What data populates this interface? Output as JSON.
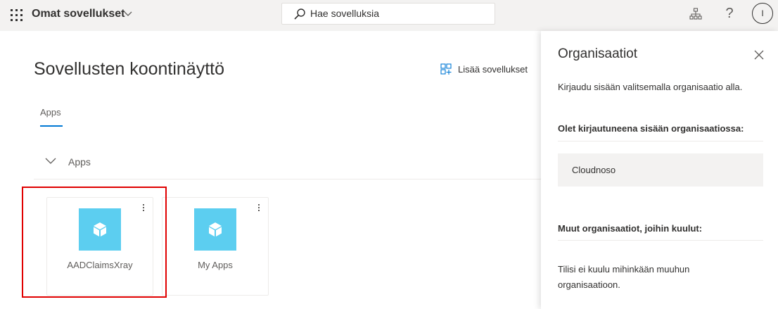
{
  "topbar": {
    "app_title": "Omat sovellukset",
    "search_placeholder": "Hae sovelluksia",
    "help_label": "?",
    "avatar_initial": "I"
  },
  "main": {
    "page_title": "Sovellusten koontinäyttö",
    "add_apps_label": "Lisää sovellukset",
    "tabs": [
      {
        "label": "Apps",
        "active": true
      }
    ],
    "section": {
      "label": "Apps"
    },
    "tiles": [
      {
        "label": "AADClaimsXray",
        "icon": "cube-icon",
        "highlighted": true
      },
      {
        "label": "My Apps",
        "icon": "cube-icon",
        "highlighted": false
      }
    ]
  },
  "panel": {
    "title": "Organisaatiot",
    "intro": "Kirjaudu sisään valitsemalla organisaatio alla.",
    "current_heading": "Olet kirjautuneena sisään organisaatiossa:",
    "current_org": "Cloudnoso",
    "other_heading": "Muut organisaatiot, joihin kuulut:",
    "other_note": "Tilisi ei kuulu mihinkään muuhun organisaatioon."
  },
  "colors": {
    "accent": "#0078d4",
    "tile_icon_bg": "#5ccef0",
    "highlight": "#e00000",
    "topbar_bg": "#f3f2f1"
  }
}
